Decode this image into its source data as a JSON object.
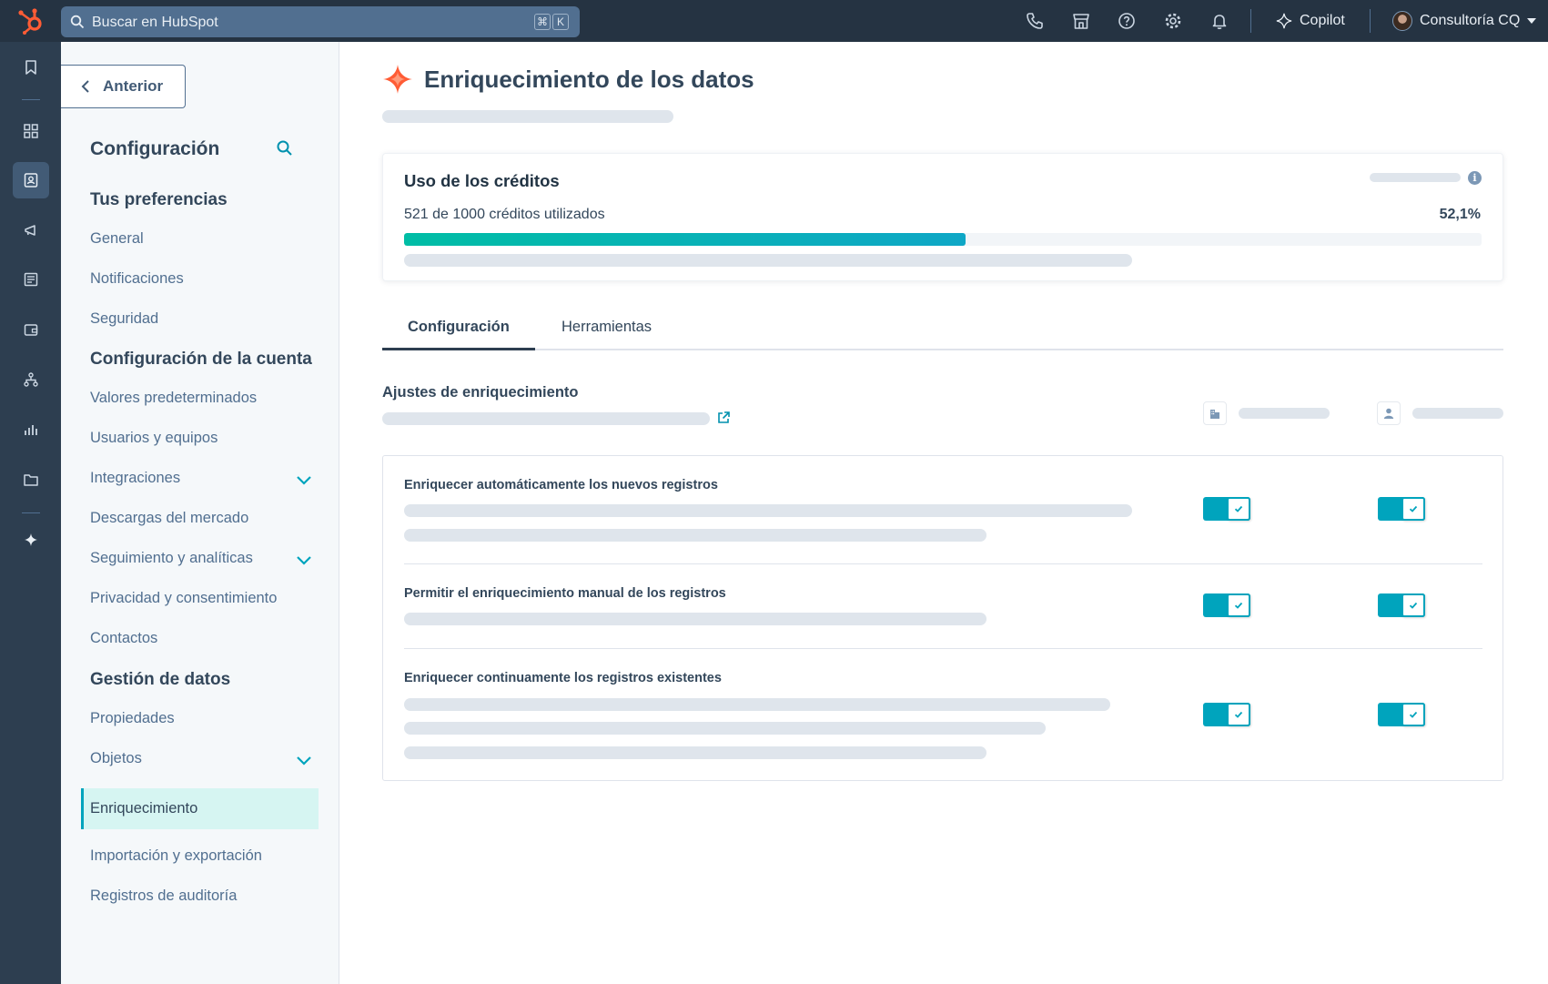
{
  "topbar": {
    "search_placeholder": "Buscar en HubSpot",
    "shortcut_keys": [
      "⌘",
      "K"
    ],
    "copilot_label": "Copilot",
    "account_name": "Consultoría CQ",
    "icons": [
      "phone-icon",
      "marketplace-icon",
      "help-icon",
      "settings-icon",
      "notifications-icon"
    ]
  },
  "rail": {
    "icons": [
      "bookmark-icon",
      "workspaces-icon",
      "contacts-icon",
      "marketing-icon",
      "content-icon",
      "commerce-icon",
      "automation-icon",
      "reporting-icon",
      "library-icon",
      "breeze-icon"
    ],
    "active": "contacts-icon"
  },
  "sidebar": {
    "back_label": "Anterior",
    "title": "Configuración",
    "sections": [
      {
        "heading": "Tus preferencias",
        "items": [
          "General",
          "Notificaciones",
          "Seguridad"
        ]
      },
      {
        "heading": "Configuración de la cuenta",
        "items": [
          "Valores predeterminados",
          "Usuarios y equipos",
          "Integraciones",
          "Descargas del mercado",
          "Seguimiento y analíticas",
          "Privacidad y consentimiento",
          "Contactos"
        ]
      },
      {
        "heading": "Gestión de datos",
        "items": [
          "Propiedades",
          "Objetos",
          "Enriquecimiento",
          "Importación y exportación",
          "Registros de auditoría"
        ]
      }
    ],
    "active_item": "Enriquecimiento"
  },
  "main": {
    "title": "Enriquecimiento de los datos",
    "credits": {
      "title": "Uso de los créditos",
      "usage_text": "521 de 1000 créditos utilizados",
      "percent_text": "52,1%",
      "used": 521,
      "total": 1000
    },
    "tabs": [
      {
        "label": "Configuración",
        "active": true
      },
      {
        "label": "Herramientas",
        "active": false
      }
    ],
    "settings_section_title": "Ajustes de enriquecimiento",
    "columns": [
      "company-icon",
      "contact-icon"
    ],
    "rows": [
      {
        "title": "Enriquecer automáticamente los nuevos registros",
        "company_enabled": true,
        "contact_enabled": true
      },
      {
        "title": "Permitir el enriquecimiento manual de los registros",
        "company_enabled": true,
        "contact_enabled": true
      },
      {
        "title": "Enriquecer continuamente los registros existentes",
        "company_enabled": true,
        "contact_enabled": true
      }
    ]
  },
  "colors": {
    "topbar": "#253342",
    "rail": "#2d3e50",
    "accent": "#00a4bd",
    "brand_orange": "#ff5c35",
    "active_item_bg": "#d6f5f2"
  }
}
